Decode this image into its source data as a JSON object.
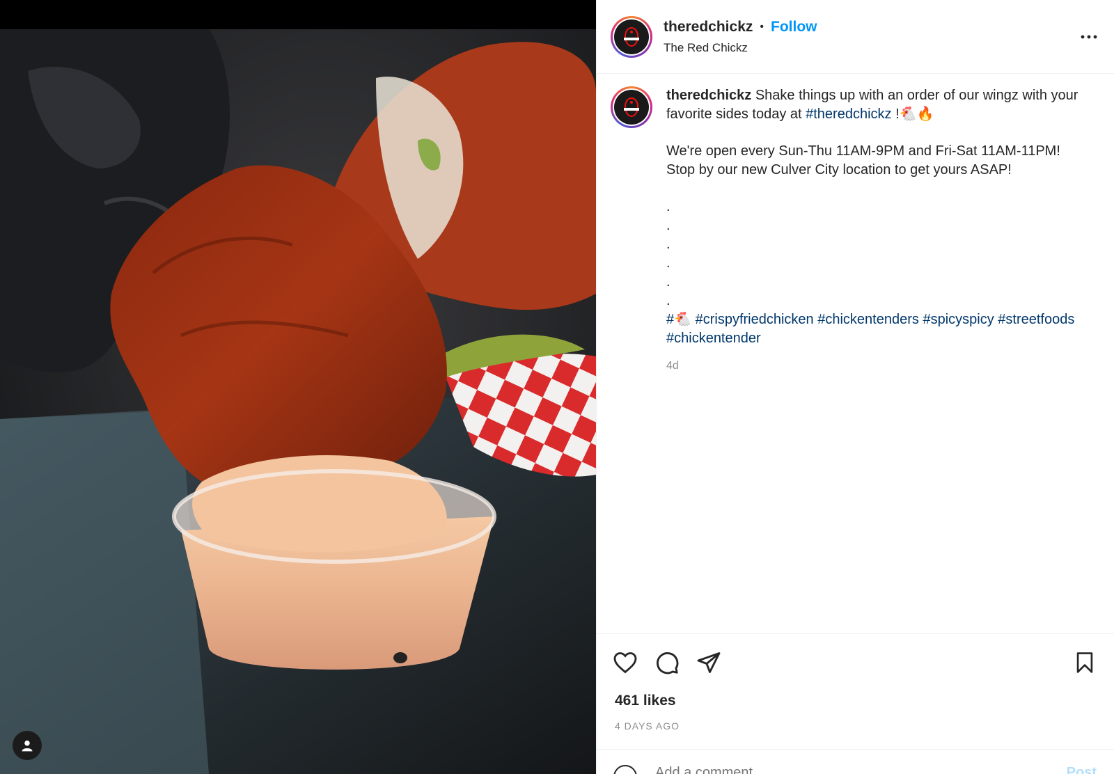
{
  "post": {
    "username": "theredchickz",
    "follow_label": "Follow",
    "location": "The Red Chickz",
    "separator": "•",
    "more_icon": "more-horizontal-icon"
  },
  "caption": {
    "username": "theredchickz",
    "line1_text": " Shake things up with an order of our wingz with your favorite sides today at ",
    "line1_hashtag": "#theredchickz",
    "line1_tail": " !🐔🔥",
    "paragraph2": "We're open every Sun-Thu 11AM-9PM and Fri-Sat 11AM-11PM! Stop by our new Culver City location to get yours ASAP!",
    "dots": [
      ".",
      ".",
      ".",
      ".",
      ".",
      "."
    ],
    "hashtags": [
      "#🐔",
      "#crispyfriedchicken",
      "#chickentenders",
      "#spicyspicy",
      "#streetfoods",
      "#chickentender"
    ],
    "age": "4d"
  },
  "actions": {
    "like_icon": "heart-icon",
    "comment_icon": "comment-icon",
    "share_icon": "send-icon",
    "save_icon": "bookmark-icon",
    "likes": "461 likes",
    "time_ago": "4 DAYS AGO"
  },
  "comment": {
    "placeholder": "Add a comment…",
    "post_label": "Post"
  },
  "colors": {
    "link_blue": "#0095f6",
    "hashtag_blue": "#00376b",
    "text": "#262626",
    "muted": "#8e8e8e"
  }
}
